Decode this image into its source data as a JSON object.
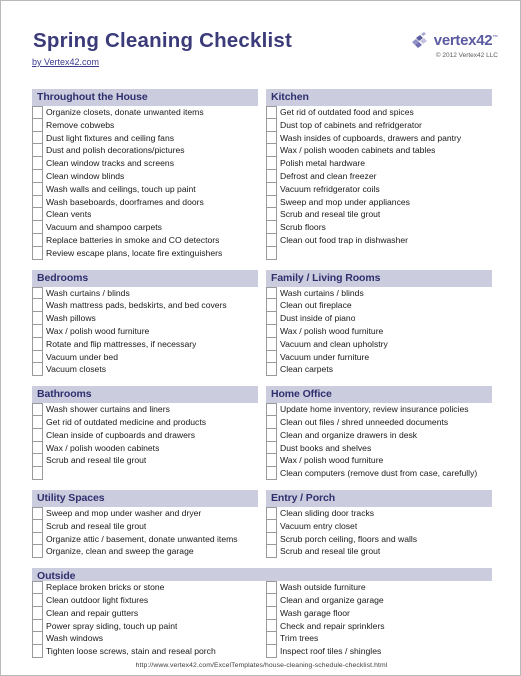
{
  "document": {
    "title": "Spring Cleaning Checklist",
    "subtitle_link": "by Vertex42.com"
  },
  "brand": {
    "name": "vertex42",
    "tm": "™",
    "copyright": "© 2012 Vertex42 LLC",
    "logo_icon": "vertex42-blocks-logo",
    "accent_color": "#5b5ba0",
    "header_band_color": "#ccccdf",
    "title_color": "#3b3b7a"
  },
  "columns": {
    "left": [
      {
        "id": "throughout-the-house",
        "heading": "Throughout the House",
        "items": [
          "Organize closets, donate unwanted items",
          "Remove cobwebs",
          "Dust light fixtures and ceiling fans",
          "Dust and polish decorations/pictures",
          "Clean window tracks and screens",
          "Clean window blinds",
          "Wash walls and ceilings, touch up paint",
          "Wash baseboards, doorframes and doors",
          "Clean vents",
          "Vacuum and shampoo carpets",
          "Replace batteries in smoke and CO detectors",
          "Review escape plans, locate fire extinguishers"
        ],
        "empty_rows": 0
      },
      {
        "id": "bedrooms",
        "heading": "Bedrooms",
        "items": [
          "Wash curtains / blinds",
          "Wash mattress pads, bedskirts, and bed covers",
          "Wash pillows",
          "Wax / polish wood furniture",
          "Rotate and flip mattresses, if necessary",
          "Vacuum under bed",
          "Vacuum closets"
        ],
        "empty_rows": 0
      },
      {
        "id": "bathrooms",
        "heading": "Bathrooms",
        "items": [
          "Wash shower curtains and liners",
          "Get rid of outdated medicine and products",
          "Clean inside of cupboards and drawers",
          "Wax / polish wooden cabinets",
          "Scrub and reseal tile grout"
        ],
        "empty_rows": 1
      },
      {
        "id": "utility-spaces",
        "heading": "Utility Spaces",
        "items": [
          "Sweep and mop under washer and dryer",
          "Scrub and reseal tile grout",
          "Organize attic / basement, donate unwanted items",
          "Organize, clean and sweep the garage"
        ],
        "empty_rows": 0
      }
    ],
    "right": [
      {
        "id": "kitchen",
        "heading": "Kitchen",
        "items": [
          "Get rid of outdated food and spices",
          "Dust top of cabinets and refridgerator",
          "Wash insides of cupboards, drawers and pantry",
          "Wax / polish wooden cabinets and tables",
          "Polish metal hardware",
          "Defrost and clean freezer",
          "Vacuum refridgerator coils",
          "Sweep and mop under appliances",
          "Scrub and reseal tile grout",
          "Scrub floors",
          "Clean out food trap in dishwasher"
        ],
        "empty_rows": 1
      },
      {
        "id": "family-living-rooms",
        "heading": "Family / Living Rooms",
        "items": [
          "Wash curtains / blinds",
          "Clean out fireplace",
          "Dust inside of piano",
          "Wax / polish wood furniture",
          "Vacuum and clean upholstry",
          "Vacuum under furniture",
          "Clean carpets"
        ],
        "empty_rows": 0
      },
      {
        "id": "home-office",
        "heading": "Home Office",
        "items": [
          "Update home inventory, review insurance policies",
          "Clean out files / shred unneeded documents",
          "Clean and organize drawers in desk",
          "Dust books and shelves",
          "Wax / polish wood furniture",
          "Clean computers (remove dust from case, carefully)"
        ],
        "empty_rows": 0
      },
      {
        "id": "entry-porch",
        "heading": "Entry / Porch",
        "items": [
          "Clean sliding door tracks",
          "Vacuum entry closet",
          "Scrub porch ceiling, floors and walls",
          "Scrub and reseal tile grout"
        ],
        "empty_rows": 0
      }
    ]
  },
  "outside": {
    "id": "outside",
    "heading": "Outside",
    "left_items": [
      "Replace broken bricks or stone",
      "Clean outdoor light fixtures",
      "Clean and repair gutters",
      "Power spray siding, touch up paint",
      "Wash windows",
      "Tighten loose screws, stain and reseal porch"
    ],
    "right_items": [
      "Wash outside furniture",
      "Clean and organize garage",
      "Wash garage floor",
      "Check and repair sprinklers",
      "Trim trees",
      "Inspect roof tiles / shingles"
    ]
  },
  "footer": {
    "url": "http://www.vertex42.com/ExcelTemplates/house-cleaning-schedule-checklist.html"
  }
}
